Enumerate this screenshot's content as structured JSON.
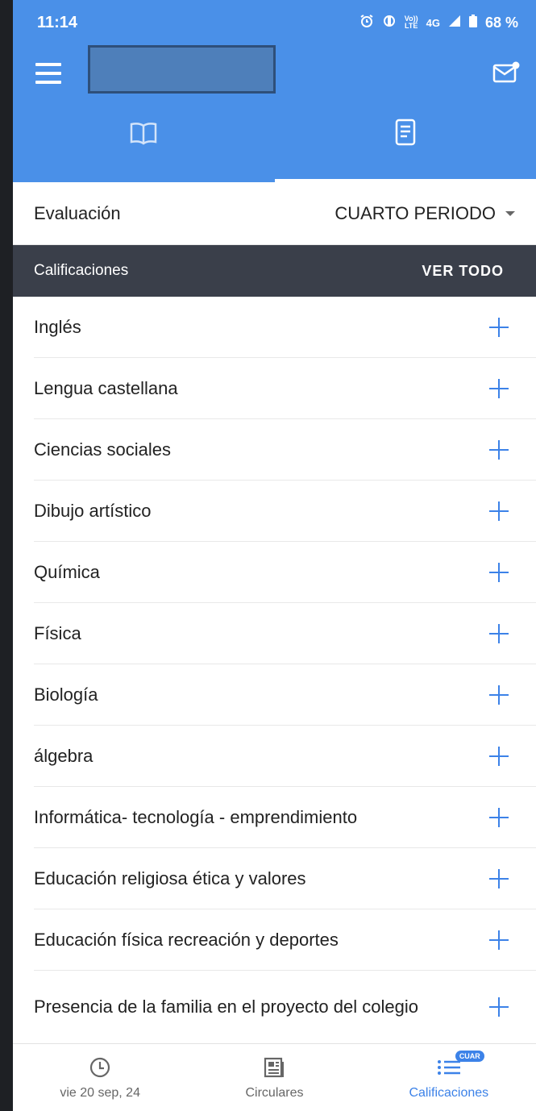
{
  "status_bar": {
    "time": "11:14",
    "volte": "Vo))",
    "lte": "LTE",
    "network": "4G",
    "battery": "68 %"
  },
  "icons": {
    "menu": "menu-icon",
    "mail": "mail-notification-icon",
    "book": "book-icon",
    "document": "document-icon",
    "alarm": "alarm-icon",
    "clock": "clock-icon",
    "newspaper": "newspaper-icon",
    "list": "list-icon"
  },
  "colors": {
    "primary": "#4a90e8",
    "header_dark": "#3a3f4a",
    "accent": "#3c82e8"
  },
  "evaluation": {
    "label": "Evaluación",
    "selected_period": "CUARTO PERIODO"
  },
  "grades": {
    "title": "Calificaciones",
    "view_all": "VER TODO",
    "subjects": [
      "Inglés",
      "Lengua castellana",
      "Ciencias sociales",
      "Dibujo artístico",
      "Química",
      "Física",
      "Biología",
      "álgebra",
      "Informática- tecnología - emprendimiento",
      "Educación religiosa ética y valores",
      "Educación física recreación y deportes",
      "Presencia de la familia en el proyecto del colegio"
    ]
  },
  "bottom_nav": {
    "items": [
      {
        "label": "vie 20 sep, 24",
        "active": false
      },
      {
        "label": "Circulares",
        "active": false
      },
      {
        "label": "Calificaciones",
        "active": true,
        "badge": "CUAR"
      }
    ]
  }
}
